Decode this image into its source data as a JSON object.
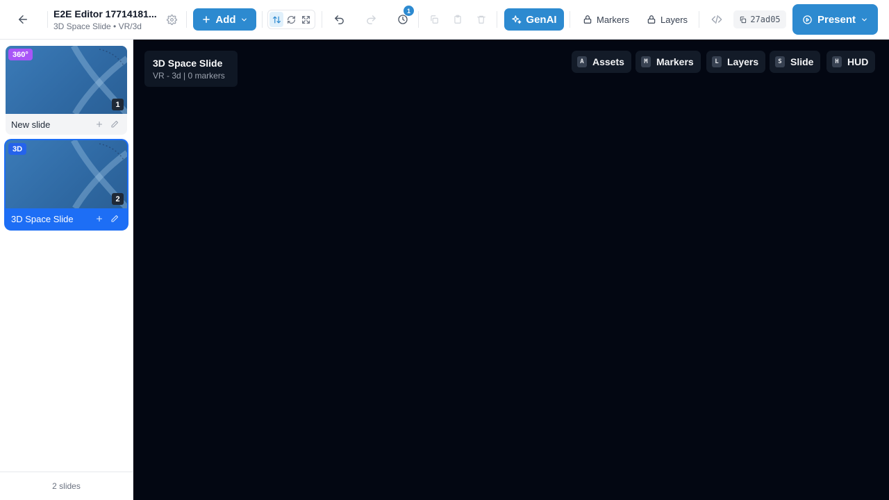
{
  "header": {
    "title": "E2E Editor 17714181...",
    "subtitle": "3D Space Slide • VR/3d",
    "add_label": "Add",
    "history_badge": "1",
    "genai_label": "GenAI",
    "markers_label": "Markers",
    "layers_label": "Layers",
    "hash": "27ad05",
    "present_label": "Present"
  },
  "sidebar": {
    "slides": [
      {
        "badge": "360°",
        "badge_color": "#a855f7",
        "number": "1",
        "name": "New slide",
        "selected": false
      },
      {
        "badge": "3D",
        "badge_color": "#2563eb",
        "number": "2",
        "name": "3D Space Slide",
        "selected": true
      }
    ],
    "footer": "2 slides"
  },
  "canvas": {
    "info_title": "3D Space Slide",
    "info_subtitle": "VR - 3d | 0 markers",
    "hud_buttons": [
      {
        "key": "A",
        "label": "Assets"
      },
      {
        "key": "M",
        "label": "Markers"
      },
      {
        "key": "L",
        "label": "Layers"
      },
      {
        "key": "S",
        "label": "Slide"
      },
      {
        "key": "H",
        "label": "HUD"
      }
    ]
  },
  "colors": {
    "accent": "#2d8ad0",
    "selected": "#1d6ef5",
    "canvas_bg": "#030712"
  }
}
